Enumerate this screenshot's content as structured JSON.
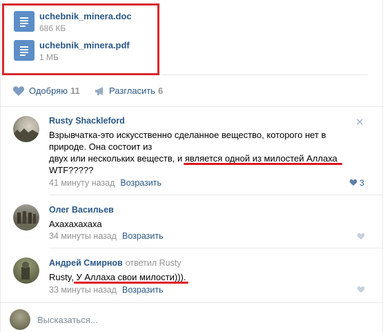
{
  "attachments": [
    {
      "name": "uchebnik_minera.doc",
      "size": "686 КБ",
      "icon": "document-icon"
    },
    {
      "name": "uchebnik_minera.pdf",
      "size": "1 МБ",
      "icon": "document-icon"
    }
  ],
  "actions": {
    "like_label": "Одобряю",
    "like_count": "11",
    "share_label": "Разгласить",
    "share_count": "6"
  },
  "comments": [
    {
      "author": "Rusty Shackleford",
      "close_glyph": "✕",
      "lines": {
        "0": "Взрывчатка-это искусственно сделанное вещество, которого нет в",
        "1": "природе. Она состоит из",
        "2a": "двух или нескольких веществ, ",
        "2b": "и является одной из милостей Аллаха",
        "3": "WTF?????"
      },
      "time": "41 минуту назад",
      "reply_label": "Возразить",
      "likes": "3"
    },
    {
      "author": "Олег Васильев",
      "lines": {
        "0": "Ахахахахаха"
      },
      "time": "34 минуты назад",
      "reply_label": "Возразить"
    },
    {
      "author": "Андрей Смирнов",
      "replied_to": "ответил Rusty",
      "mention": "Rusty, ",
      "text": "У Аллаха свои милости))).",
      "time": "33 минуты назад",
      "reply_label": "Возразить"
    }
  ],
  "composer": {
    "placeholder": "Высказаться..."
  },
  "colors": {
    "link": "#2a5885",
    "muted": "#939393",
    "highlight_red": "#d8272d",
    "doc_icon": "#5d8ec7"
  }
}
